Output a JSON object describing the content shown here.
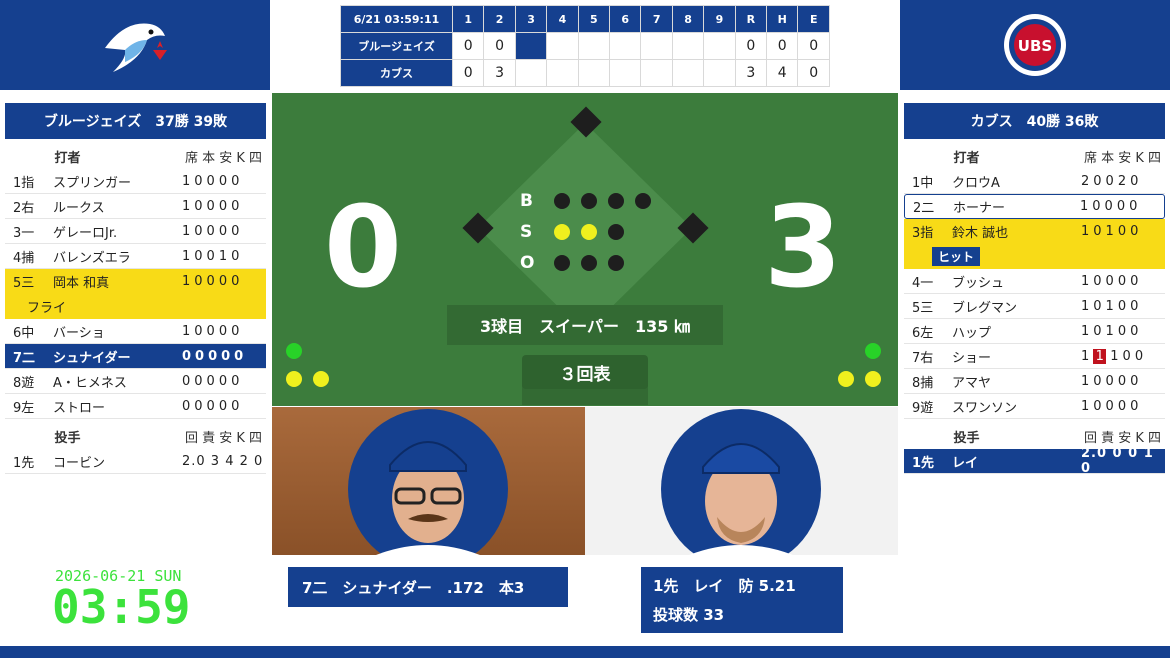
{
  "scoreboard": {
    "datetime": "6/21 03:59:11",
    "innings": [
      "1",
      "2",
      "3",
      "4",
      "5",
      "6",
      "7",
      "8",
      "9"
    ],
    "totals_headers": [
      "R",
      "H",
      "E"
    ],
    "teams": [
      {
        "name": "ブルージェイズ",
        "innings": [
          "0",
          "0",
          "",
          "",
          "",
          "",
          "",
          "",
          ""
        ],
        "totals": [
          "0",
          "0",
          "0"
        ]
      },
      {
        "name": "カブス",
        "innings": [
          "0",
          "3",
          "",
          "",
          "",
          "",
          "",
          "",
          ""
        ],
        "totals": [
          "3",
          "4",
          "0"
        ]
      }
    ]
  },
  "left": {
    "team_record": "ブルージェイズ　37勝 39敗",
    "batter_header": "打者",
    "batter_stats_header": "席 本 安 K 四",
    "batters": [
      {
        "pos": "1指",
        "name": "スプリンガー",
        "stats": "10000"
      },
      {
        "pos": "2右",
        "name": "ルークス",
        "stats": "10000"
      },
      {
        "pos": "3一",
        "name": "ゲレーロJr.",
        "stats": "10000"
      },
      {
        "pos": "4捕",
        "name": "バレンズエラ",
        "stats": "10010"
      },
      {
        "pos": "5三",
        "name": "岡本 和真",
        "stats": "10000"
      },
      {
        "pos": "6中",
        "name": "バーショ",
        "stats": "10000"
      },
      {
        "pos": "7二",
        "name": "シュナイダー",
        "stats": "00000"
      },
      {
        "pos": "8遊",
        "name": "A・ヒメネス",
        "stats": "00000"
      },
      {
        "pos": "9左",
        "name": "ストロー",
        "stats": "00000"
      }
    ],
    "result_text": "フライ",
    "pitcher_header": "投手",
    "pitcher_stats_header": "回 責 安 K 四",
    "pitchers": [
      {
        "pos": "1先",
        "name": "コービン",
        "stats": "2.0 3 4 2 0"
      }
    ]
  },
  "right": {
    "team_record": "カブス　40勝 36敗",
    "batter_header": "打者",
    "batter_stats_header": "席 本 安 K 四",
    "batters": [
      {
        "pos": "1中",
        "name": "クロウA",
        "stats": "20020"
      },
      {
        "pos": "2二",
        "name": "ホーナー",
        "stats": "10000"
      },
      {
        "pos": "3指",
        "name": "鈴木 誠也",
        "stats": "10100"
      },
      {
        "pos": "4一",
        "name": "ブッシュ",
        "stats": "10000"
      },
      {
        "pos": "5三",
        "name": "ブレグマン",
        "stats": "10100"
      },
      {
        "pos": "6左",
        "name": "ハップ",
        "stats": "10100"
      },
      {
        "pos": "7右",
        "name": "ショー",
        "stats_a": "1",
        "stats_b": "1",
        "stats_c": "100"
      },
      {
        "pos": "8捕",
        "name": "アマヤ",
        "stats": "10000"
      },
      {
        "pos": "9遊",
        "name": "スワンソン",
        "stats": "10000"
      }
    ],
    "result_badge": "ヒット",
    "pitcher_header": "投手",
    "pitcher_stats_header": "回 責 安 K 四",
    "pitchers": [
      {
        "pos": "1先",
        "name": "レイ",
        "stats": "2.0 0 0 1 0"
      }
    ]
  },
  "field": {
    "away_score": "0",
    "home_score": "3",
    "count_labels": [
      "B",
      "S",
      "O"
    ],
    "pitch_info": "3球目　スイーパー　135 ㎞",
    "inning": "３回表"
  },
  "bottom": {
    "batter_info": "7二　シュナイダー　.172　本3",
    "pitcher_line1": "1先　レイ　防 5.21",
    "pitcher_line2": "投球数 33"
  },
  "clock": {
    "date": "2026-06-21 SUN",
    "time": "03:59"
  },
  "colors": {
    "primary": "#15408f",
    "highlight": "#f8db17",
    "field": "#3c7c3c",
    "clock": "#3ce23c"
  }
}
